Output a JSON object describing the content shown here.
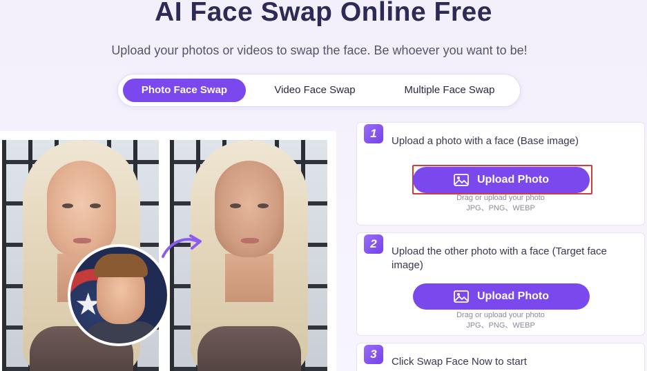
{
  "header": {
    "title": "AI Face Swap Online Free",
    "subtitle": "Upload your photos or videos to swap the face. Be whoever you want to be!"
  },
  "tabs": [
    {
      "label": "Photo Face Swap",
      "active": true
    },
    {
      "label": "Video Face Swap",
      "active": false
    },
    {
      "label": "Multiple Face Swap",
      "active": false
    }
  ],
  "steps": [
    {
      "number": "1",
      "text": "Upload a photo with a face (Base image)",
      "button_label": "Upload Photo",
      "hint": "Drag or upload your photo",
      "formats": "JPG、PNG、WEBP"
    },
    {
      "number": "2",
      "text": "Upload the other photo with a face (Target face image)",
      "button_label": "Upload Photo",
      "hint": "Drag or upload your photo",
      "formats": "JPG、PNG、WEBP"
    },
    {
      "number": "3",
      "text": "Click Swap Face Now to start"
    }
  ],
  "colors": {
    "accent": "#7b48ee",
    "highlight": "#d43a3a",
    "title": "#2d2a55"
  },
  "icons": [
    "image-upload-icon",
    "curved-arrow-icon",
    "star-icon"
  ]
}
